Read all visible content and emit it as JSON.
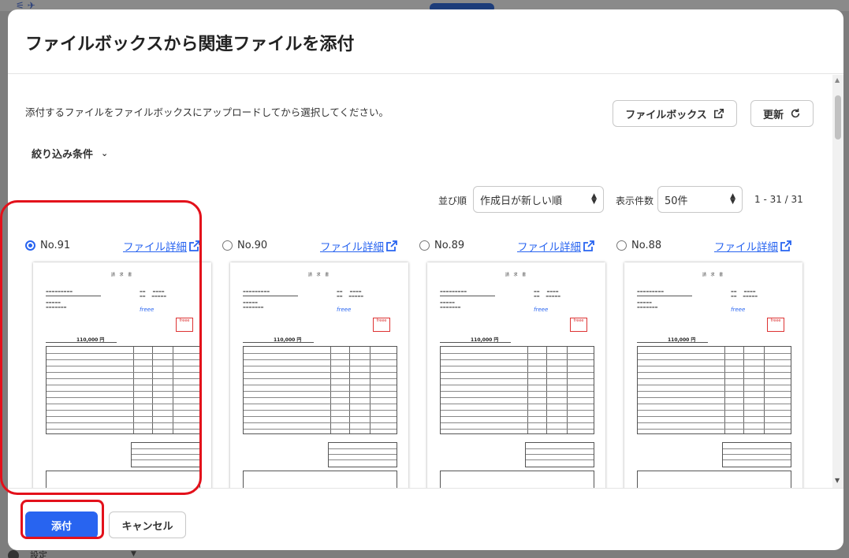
{
  "modal": {
    "title": "ファイルボックスから関連ファイルを添付",
    "description": "添付するファイルをファイルボックスにアップロードしてから選択してください。",
    "filebox_button": "ファイルボックス",
    "refresh_button": "更新",
    "filter_label": "絞り込み条件",
    "sort_label": "並び順",
    "sort_value": "作成日が新しい順",
    "count_label": "表示件数",
    "count_value": "50件",
    "range_text": "1 - 31 / 31",
    "detail_link_label": "ファイル詳細",
    "cards": [
      {
        "no": "No.91",
        "selected": true
      },
      {
        "no": "No.90",
        "selected": false
      },
      {
        "no": "No.89",
        "selected": false
      },
      {
        "no": "No.88",
        "selected": false
      }
    ],
    "document": {
      "heading": "請 求 書",
      "amount": "110,000 円",
      "brand": "freee",
      "stamp": "freee"
    },
    "attach_button": "添付",
    "cancel_button": "キャンセル"
  },
  "background": {
    "settings_label": "設定"
  },
  "colors": {
    "accent": "#2864f0",
    "highlight": "#e3111b"
  }
}
